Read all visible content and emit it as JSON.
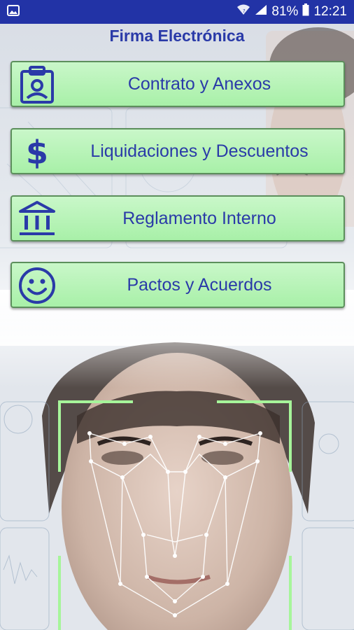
{
  "status_bar": {
    "battery": "81%",
    "time": "12:21",
    "icons": [
      "image-icon",
      "wifi-icon",
      "signal-icon",
      "battery-icon"
    ]
  },
  "title": "Firma Electrónica",
  "menu": [
    {
      "label": "Contrato y Anexos",
      "icon": "id-badge-icon"
    },
    {
      "label": "Liquidaciones y Descuentos",
      "icon": "dollar-icon"
    },
    {
      "label": "Reglamento Interno",
      "icon": "bank-icon"
    },
    {
      "label": "Pactos y Acuerdos",
      "icon": "smiley-icon"
    }
  ],
  "colors": {
    "status_bar": "#2233a6",
    "accent": "#2a3aa8",
    "button_fill": "#b5f3b5",
    "button_border": "#5c8f5c",
    "face_mesh_frame": "#a6f59a"
  }
}
